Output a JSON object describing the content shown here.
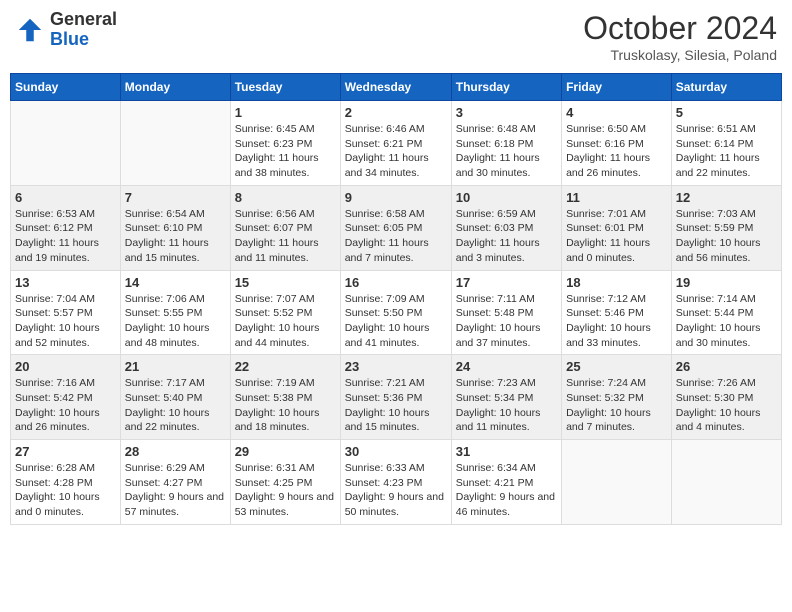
{
  "header": {
    "logo": {
      "line1": "General",
      "line2": "Blue"
    },
    "month_title": "October 2024",
    "location": "Truskolasy, Silesia, Poland"
  },
  "weekdays": [
    "Sunday",
    "Monday",
    "Tuesday",
    "Wednesday",
    "Thursday",
    "Friday",
    "Saturday"
  ],
  "weeks": [
    [
      {
        "day": "",
        "info": ""
      },
      {
        "day": "",
        "info": ""
      },
      {
        "day": "1",
        "info": "Sunrise: 6:45 AM\nSunset: 6:23 PM\nDaylight: 11 hours and 38 minutes."
      },
      {
        "day": "2",
        "info": "Sunrise: 6:46 AM\nSunset: 6:21 PM\nDaylight: 11 hours and 34 minutes."
      },
      {
        "day": "3",
        "info": "Sunrise: 6:48 AM\nSunset: 6:18 PM\nDaylight: 11 hours and 30 minutes."
      },
      {
        "day": "4",
        "info": "Sunrise: 6:50 AM\nSunset: 6:16 PM\nDaylight: 11 hours and 26 minutes."
      },
      {
        "day": "5",
        "info": "Sunrise: 6:51 AM\nSunset: 6:14 PM\nDaylight: 11 hours and 22 minutes."
      }
    ],
    [
      {
        "day": "6",
        "info": "Sunrise: 6:53 AM\nSunset: 6:12 PM\nDaylight: 11 hours and 19 minutes."
      },
      {
        "day": "7",
        "info": "Sunrise: 6:54 AM\nSunset: 6:10 PM\nDaylight: 11 hours and 15 minutes."
      },
      {
        "day": "8",
        "info": "Sunrise: 6:56 AM\nSunset: 6:07 PM\nDaylight: 11 hours and 11 minutes."
      },
      {
        "day": "9",
        "info": "Sunrise: 6:58 AM\nSunset: 6:05 PM\nDaylight: 11 hours and 7 minutes."
      },
      {
        "day": "10",
        "info": "Sunrise: 6:59 AM\nSunset: 6:03 PM\nDaylight: 11 hours and 3 minutes."
      },
      {
        "day": "11",
        "info": "Sunrise: 7:01 AM\nSunset: 6:01 PM\nDaylight: 11 hours and 0 minutes."
      },
      {
        "day": "12",
        "info": "Sunrise: 7:03 AM\nSunset: 5:59 PM\nDaylight: 10 hours and 56 minutes."
      }
    ],
    [
      {
        "day": "13",
        "info": "Sunrise: 7:04 AM\nSunset: 5:57 PM\nDaylight: 10 hours and 52 minutes."
      },
      {
        "day": "14",
        "info": "Sunrise: 7:06 AM\nSunset: 5:55 PM\nDaylight: 10 hours and 48 minutes."
      },
      {
        "day": "15",
        "info": "Sunrise: 7:07 AM\nSunset: 5:52 PM\nDaylight: 10 hours and 44 minutes."
      },
      {
        "day": "16",
        "info": "Sunrise: 7:09 AM\nSunset: 5:50 PM\nDaylight: 10 hours and 41 minutes."
      },
      {
        "day": "17",
        "info": "Sunrise: 7:11 AM\nSunset: 5:48 PM\nDaylight: 10 hours and 37 minutes."
      },
      {
        "day": "18",
        "info": "Sunrise: 7:12 AM\nSunset: 5:46 PM\nDaylight: 10 hours and 33 minutes."
      },
      {
        "day": "19",
        "info": "Sunrise: 7:14 AM\nSunset: 5:44 PM\nDaylight: 10 hours and 30 minutes."
      }
    ],
    [
      {
        "day": "20",
        "info": "Sunrise: 7:16 AM\nSunset: 5:42 PM\nDaylight: 10 hours and 26 minutes."
      },
      {
        "day": "21",
        "info": "Sunrise: 7:17 AM\nSunset: 5:40 PM\nDaylight: 10 hours and 22 minutes."
      },
      {
        "day": "22",
        "info": "Sunrise: 7:19 AM\nSunset: 5:38 PM\nDaylight: 10 hours and 18 minutes."
      },
      {
        "day": "23",
        "info": "Sunrise: 7:21 AM\nSunset: 5:36 PM\nDaylight: 10 hours and 15 minutes."
      },
      {
        "day": "24",
        "info": "Sunrise: 7:23 AM\nSunset: 5:34 PM\nDaylight: 10 hours and 11 minutes."
      },
      {
        "day": "25",
        "info": "Sunrise: 7:24 AM\nSunset: 5:32 PM\nDaylight: 10 hours and 7 minutes."
      },
      {
        "day": "26",
        "info": "Sunrise: 7:26 AM\nSunset: 5:30 PM\nDaylight: 10 hours and 4 minutes."
      }
    ],
    [
      {
        "day": "27",
        "info": "Sunrise: 6:28 AM\nSunset: 4:28 PM\nDaylight: 10 hours and 0 minutes."
      },
      {
        "day": "28",
        "info": "Sunrise: 6:29 AM\nSunset: 4:27 PM\nDaylight: 9 hours and 57 minutes."
      },
      {
        "day": "29",
        "info": "Sunrise: 6:31 AM\nSunset: 4:25 PM\nDaylight: 9 hours and 53 minutes."
      },
      {
        "day": "30",
        "info": "Sunrise: 6:33 AM\nSunset: 4:23 PM\nDaylight: 9 hours and 50 minutes."
      },
      {
        "day": "31",
        "info": "Sunrise: 6:34 AM\nSunset: 4:21 PM\nDaylight: 9 hours and 46 minutes."
      },
      {
        "day": "",
        "info": ""
      },
      {
        "day": "",
        "info": ""
      }
    ]
  ]
}
